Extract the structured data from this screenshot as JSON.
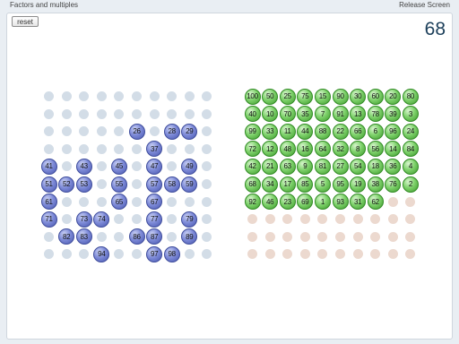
{
  "header": {
    "title": "Factors and multiples",
    "release_label": "Release Screen"
  },
  "controls": {
    "reset_label": "reset",
    "counter": "68"
  },
  "colors": {
    "blue_ball": "#6a78cc",
    "green_ball": "#5cbf49",
    "left_empty_dot": "#d3dde7",
    "right_empty_dot": "#ecd9cf"
  },
  "left_grid": {
    "rows": [
      [
        null,
        null,
        null,
        null,
        null,
        null,
        null,
        null,
        null,
        null
      ],
      [
        null,
        null,
        null,
        null,
        null,
        null,
        null,
        null,
        null,
        null
      ],
      [
        null,
        null,
        null,
        null,
        null,
        "26",
        null,
        "28",
        "29",
        null
      ],
      [
        null,
        null,
        null,
        null,
        null,
        null,
        "37",
        null,
        null,
        null
      ],
      [
        "41",
        null,
        "43",
        null,
        "45",
        null,
        "47",
        null,
        "49",
        null
      ],
      [
        "51",
        "52",
        "53",
        null,
        "55",
        null,
        "57",
        "58",
        "59",
        null
      ],
      [
        "61",
        null,
        null,
        null,
        "65",
        null,
        "67",
        null,
        null,
        null
      ],
      [
        "71",
        null,
        "73",
        "74",
        null,
        null,
        "77",
        null,
        "79",
        null
      ],
      [
        null,
        "82",
        "83",
        null,
        null,
        "86",
        "87",
        null,
        "89",
        null
      ],
      [
        null,
        null,
        null,
        "94",
        null,
        null,
        "97",
        "98",
        null,
        null
      ]
    ]
  },
  "right_grid": {
    "rows": [
      [
        "100",
        "50",
        "25",
        "75",
        "15",
        "90",
        "30",
        "60",
        "20",
        "80"
      ],
      [
        "40",
        "10",
        "70",
        "35",
        "7",
        "91",
        "13",
        "78",
        "39",
        "3"
      ],
      [
        "99",
        "33",
        "11",
        "44",
        "88",
        "22",
        "66",
        "6",
        "96",
        "24"
      ],
      [
        "72",
        "12",
        "48",
        "16",
        "64",
        "32",
        "8",
        "56",
        "14",
        "84"
      ],
      [
        "42",
        "21",
        "63",
        "9",
        "81",
        "27",
        "54",
        "18",
        "36",
        "4"
      ],
      [
        "68",
        "34",
        "17",
        "85",
        "5",
        "95",
        "19",
        "38",
        "76",
        "2"
      ],
      [
        "92",
        "46",
        "23",
        "69",
        "1",
        "93",
        "31",
        "62",
        null,
        null
      ],
      [
        null,
        null,
        null,
        null,
        null,
        null,
        null,
        null,
        null,
        null
      ],
      [
        null,
        null,
        null,
        null,
        null,
        null,
        null,
        null,
        null,
        null
      ],
      [
        null,
        null,
        null,
        null,
        null,
        null,
        null,
        null,
        null,
        null
      ]
    ]
  }
}
